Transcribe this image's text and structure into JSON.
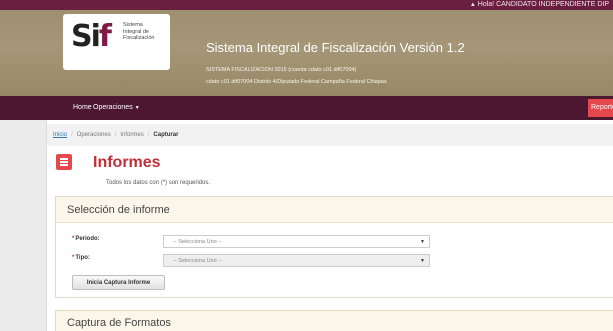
{
  "user": {
    "label": "Hola! CANDIDATO INDEPENDIENTE DIP",
    "icon": "user-icon"
  },
  "logo": {
    "mark_s": "S",
    "mark_i": "i",
    "mark_f": "f",
    "subtitle_1": "Sistema",
    "subtitle_2": "Integral de",
    "subtitle_3": "Fiscalización"
  },
  "header": {
    "title": "Sistema Integral de Fiscalización Versión 1.2",
    "line2": "SISTEMA FISCALIZACION 2015 (cuenta cdato c01 dif07004)",
    "line3": "cdato c01 dif07004 Distrito 4/Diputado Federal Campaña Federal Chiapas"
  },
  "nav": {
    "home": "Home",
    "operaciones": "Operaciones",
    "report": "Reporte"
  },
  "breadcrumb": {
    "inicio": "Inicio",
    "operaciones": "Operaciones",
    "informes": "Informes",
    "capturar": "Capturar"
  },
  "page": {
    "title": "Informes",
    "required_note": "Todos los datos con (*) son requeridos."
  },
  "panel": {
    "heading": "Selección de informe",
    "periodo_label": "Periodo:",
    "tipo_label": "Tipo:",
    "required_mark": "*",
    "periodo_value": "-- Selecciona Uno --",
    "tipo_value": "-- Selecciona Uno --",
    "button": "Inicia Captura Informe"
  },
  "panel2": {
    "heading": "Captura de Formatos"
  },
  "colors": {
    "brand": "#6b1f3e",
    "header_bg": "#a49676",
    "nav_bg": "#4d1731",
    "accent": "#c1303a",
    "report_btn": "#e4484d"
  }
}
